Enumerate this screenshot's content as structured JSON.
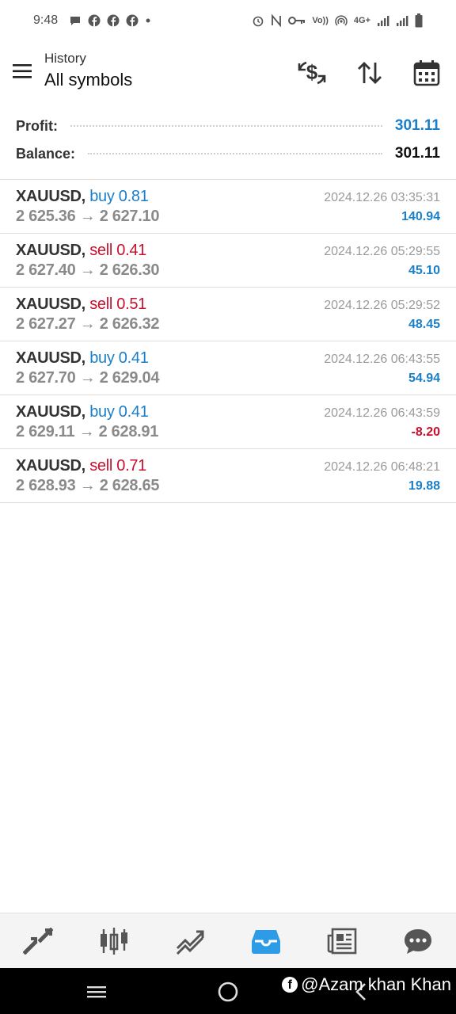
{
  "status_bar": {
    "time": "9:48",
    "left_icons": [
      "chat-bubble-icon",
      "facebook-icon",
      "facebook-icon",
      "facebook-icon",
      "dot-icon"
    ],
    "right_icons": [
      "alarm-icon",
      "nfc-icon",
      "key-icon",
      "volte-icon",
      "hotspot-icon",
      "signal-icon",
      "signal-icon",
      "battery-icon"
    ],
    "network": "4G+",
    "volte": "Vo))"
  },
  "header": {
    "subtitle": "History",
    "title": "All symbols",
    "actions": [
      "currency-exchange-icon",
      "sort-icon",
      "calendar-icon"
    ]
  },
  "summary": {
    "profit_label": "Profit:",
    "profit_value": "301.11",
    "balance_label": "Balance:",
    "balance_value": "301.11"
  },
  "colors": {
    "buy": "#1a7fc9",
    "sell": "#c8102e",
    "profit_positive": "#1a7fc9",
    "profit_negative": "#c8102e",
    "nav_active": "#2e9be6"
  },
  "deals": [
    {
      "symbol": "XAUUSD,",
      "side": "buy 0.81",
      "type": "buy",
      "open": "2 625.36",
      "arrow": "→",
      "close": "2 627.10",
      "time": "2024.12.26 03:35:31",
      "profit": "140.94",
      "profit_sign": "positive"
    },
    {
      "symbol": "XAUUSD,",
      "side": "sell 0.41",
      "type": "sell",
      "open": "2 627.40",
      "arrow": "→",
      "close": "2 626.30",
      "time": "2024.12.26 05:29:55",
      "profit": "45.10",
      "profit_sign": "positive"
    },
    {
      "symbol": "XAUUSD,",
      "side": "sell 0.51",
      "type": "sell",
      "open": "2 627.27",
      "arrow": "→",
      "close": "2 626.32",
      "time": "2024.12.26 05:29:52",
      "profit": "48.45",
      "profit_sign": "positive"
    },
    {
      "symbol": "XAUUSD,",
      "side": "buy 0.41",
      "type": "buy",
      "open": "2 627.70",
      "arrow": "→",
      "close": "2 629.04",
      "time": "2024.12.26 06:43:55",
      "profit": "54.94",
      "profit_sign": "positive"
    },
    {
      "symbol": "XAUUSD,",
      "side": "buy 0.41",
      "type": "buy",
      "open": "2 629.11",
      "arrow": "→",
      "close": "2 628.91",
      "time": "2024.12.26 06:43:59",
      "profit": "-8.20",
      "profit_sign": "negative"
    },
    {
      "symbol": "XAUUSD,",
      "side": "sell 0.71",
      "type": "sell",
      "open": "2 628.93",
      "arrow": "→",
      "close": "2 628.65",
      "time": "2024.12.26 06:48:21",
      "profit": "19.88",
      "profit_sign": "positive"
    }
  ],
  "bottom_nav": {
    "items": [
      "quotes-icon",
      "chart-icon",
      "trade-icon",
      "history-icon",
      "news-icon",
      "messages-icon"
    ],
    "active": "history-icon"
  },
  "system_nav": {
    "buttons": [
      "recents-icon",
      "home-icon",
      "back-icon"
    ]
  },
  "watermark": {
    "text": "@Azam khan Khan",
    "logo": "facebook-icon"
  }
}
